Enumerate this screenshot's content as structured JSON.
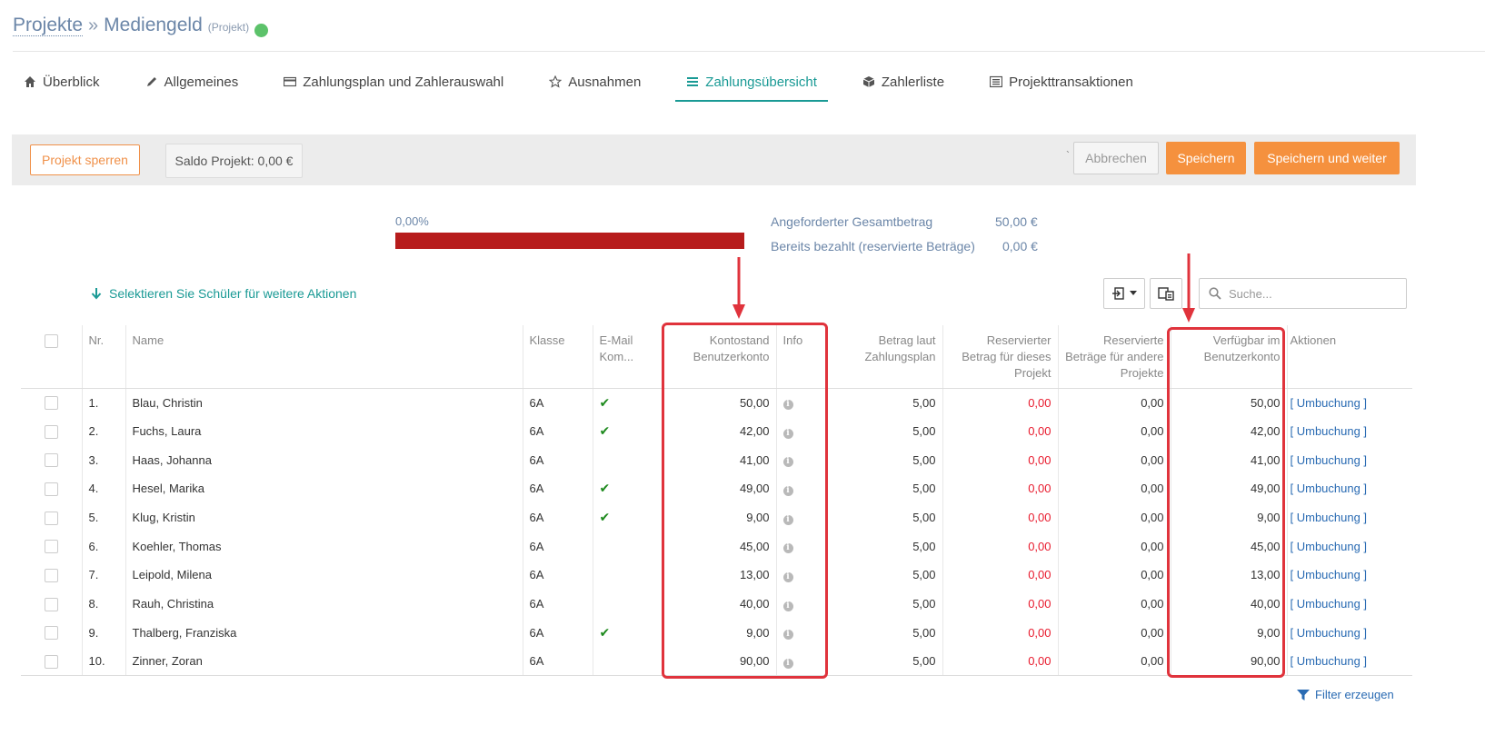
{
  "header": {
    "breadcrumb_link": "Projekte",
    "separator": "»",
    "project_title": "Mediengeld",
    "project_type": "(Projekt)",
    "status_color": "#5cc26a"
  },
  "tabs": [
    {
      "label": "Überblick",
      "icon": "home-icon"
    },
    {
      "label": "Allgemeines",
      "icon": "pencil-icon"
    },
    {
      "label": "Zahlungsplan und Zahlerauswahl",
      "icon": "credit-card-icon"
    },
    {
      "label": "Ausnahmen",
      "icon": "star-icon"
    },
    {
      "label": "Zahlungsübersicht",
      "icon": "list-icon",
      "active": true
    },
    {
      "label": "Zahlerliste",
      "icon": "cube-icon"
    },
    {
      "label": "Projekttransaktionen",
      "icon": "list-alt-icon"
    }
  ],
  "toolbar": {
    "lock_label": "Projekt sperren",
    "saldo": "Saldo Projekt: 0,00 €",
    "tick": "`",
    "cancel_label": "Abbrechen",
    "save_label": "Speichern",
    "save_next_label": "Speichern und weiter"
  },
  "summary": {
    "progress_label": "0,00%",
    "progress_fraction": 1.0,
    "requested_label": "Angeforderter Gesamtbetrag",
    "requested_value": "50,00 €",
    "paid_label": "Bereits bezahlt (reservierte Beträge)",
    "paid_value": "0,00 €"
  },
  "actions": {
    "select_hint": "Selektieren Sie Schüler für weitere Aktionen",
    "search_placeholder": "Suche..."
  },
  "table": {
    "headers": {
      "nr": "Nr.",
      "name": "Name",
      "klasse": "Klasse",
      "email": "E-Mail Kom...",
      "kontostand": "Kontostand Benutzerkonto",
      "info": "Info",
      "betrag": "Betrag laut Zahlungsplan",
      "reserviert_projekt": "Reservierter Betrag für dieses Projekt",
      "reserviert_andere": "Reservierte Beträge für andere Projekte",
      "verfuegbar": "Verfügbar im Benutzerkonto",
      "aktionen": "Aktionen"
    },
    "rows": [
      {
        "nr": "1.",
        "name": "Blau, Christin",
        "klasse": "6A",
        "email": true,
        "kontostand": "50,00",
        "betrag": "5,00",
        "res_proj": "0,00",
        "res_andere": "0,00",
        "verfuegbar": "50,00",
        "aktion": "[ Umbuchung ]"
      },
      {
        "nr": "2.",
        "name": "Fuchs, Laura",
        "klasse": "6A",
        "email": true,
        "kontostand": "42,00",
        "betrag": "5,00",
        "res_proj": "0,00",
        "res_andere": "0,00",
        "verfuegbar": "42,00",
        "aktion": "[ Umbuchung ]"
      },
      {
        "nr": "3.",
        "name": "Haas, Johanna",
        "klasse": "6A",
        "email": false,
        "kontostand": "41,00",
        "betrag": "5,00",
        "res_proj": "0,00",
        "res_andere": "0,00",
        "verfuegbar": "41,00",
        "aktion": "[ Umbuchung ]"
      },
      {
        "nr": "4.",
        "name": "Hesel, Marika",
        "klasse": "6A",
        "email": true,
        "kontostand": "49,00",
        "betrag": "5,00",
        "res_proj": "0,00",
        "res_andere": "0,00",
        "verfuegbar": "49,00",
        "aktion": "[ Umbuchung ]"
      },
      {
        "nr": "5.",
        "name": "Klug, Kristin",
        "klasse": "6A",
        "email": true,
        "kontostand": "9,00",
        "betrag": "5,00",
        "res_proj": "0,00",
        "res_andere": "0,00",
        "verfuegbar": "9,00",
        "aktion": "[ Umbuchung ]"
      },
      {
        "nr": "6.",
        "name": "Koehler, Thomas",
        "klasse": "6A",
        "email": false,
        "kontostand": "45,00",
        "betrag": "5,00",
        "res_proj": "0,00",
        "res_andere": "0,00",
        "verfuegbar": "45,00",
        "aktion": "[ Umbuchung ]"
      },
      {
        "nr": "7.",
        "name": "Leipold, Milena",
        "klasse": "6A",
        "email": false,
        "kontostand": "13,00",
        "betrag": "5,00",
        "res_proj": "0,00",
        "res_andere": "0,00",
        "verfuegbar": "13,00",
        "aktion": "[ Umbuchung ]"
      },
      {
        "nr": "8.",
        "name": "Rauh, Christina",
        "klasse": "6A",
        "email": false,
        "kontostand": "40,00",
        "betrag": "5,00",
        "res_proj": "0,00",
        "res_andere": "0,00",
        "verfuegbar": "40,00",
        "aktion": "[ Umbuchung ]"
      },
      {
        "nr": "9.",
        "name": "Thalberg, Franziska",
        "klasse": "6A",
        "email": true,
        "kontostand": "9,00",
        "betrag": "5,00",
        "res_proj": "0,00",
        "res_andere": "0,00",
        "verfuegbar": "9,00",
        "aktion": "[ Umbuchung ]"
      },
      {
        "nr": "10.",
        "name": "Zinner, Zoran",
        "klasse": "6A",
        "email": false,
        "kontostand": "90,00",
        "betrag": "5,00",
        "res_proj": "0,00",
        "res_andere": "0,00",
        "verfuegbar": "90,00",
        "aktion": "[ Umbuchung ]"
      }
    ]
  },
  "footer": {
    "filter_label": "Filter erzeugen"
  },
  "colors": {
    "accent": "#1a9a95",
    "orange": "#f5913e",
    "progress": "#b71c1c",
    "highlight": "#e0333c",
    "negative": "#e8192c",
    "link": "#2a6bb3"
  }
}
